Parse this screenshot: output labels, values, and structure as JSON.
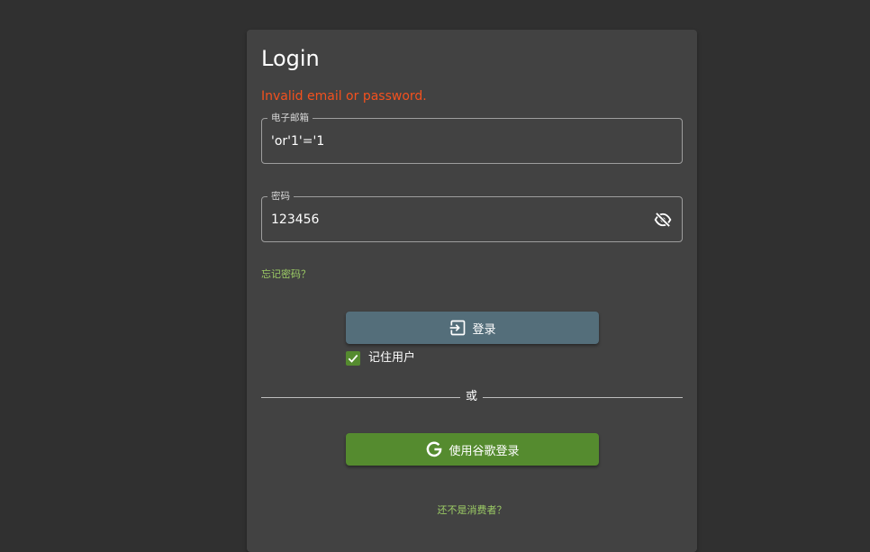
{
  "login": {
    "title": "Login",
    "error_message": "Invalid email or password.",
    "email_label": "电子邮箱",
    "email_value": "'or'1'='1",
    "password_label": "密码",
    "password_value": "123456",
    "password_toggle_icon": "eye-off-icon",
    "forgot_password": "忘记密码？",
    "login_button": "登录",
    "login_icon": "login-icon",
    "remember_me": "记住用户",
    "remember_me_checked": true,
    "divider_text": "或",
    "google_button": "使用谷歌登录",
    "google_icon": "google-icon",
    "not_customer": "还不是消费者？"
  },
  "colors": {
    "page_bg": "#303030",
    "card_bg": "#424242",
    "error": "#f4511e",
    "link": "#9ccc65",
    "login_button": "#546e7a",
    "google_button": "#558b2f",
    "checkbox": "#558b2f"
  }
}
